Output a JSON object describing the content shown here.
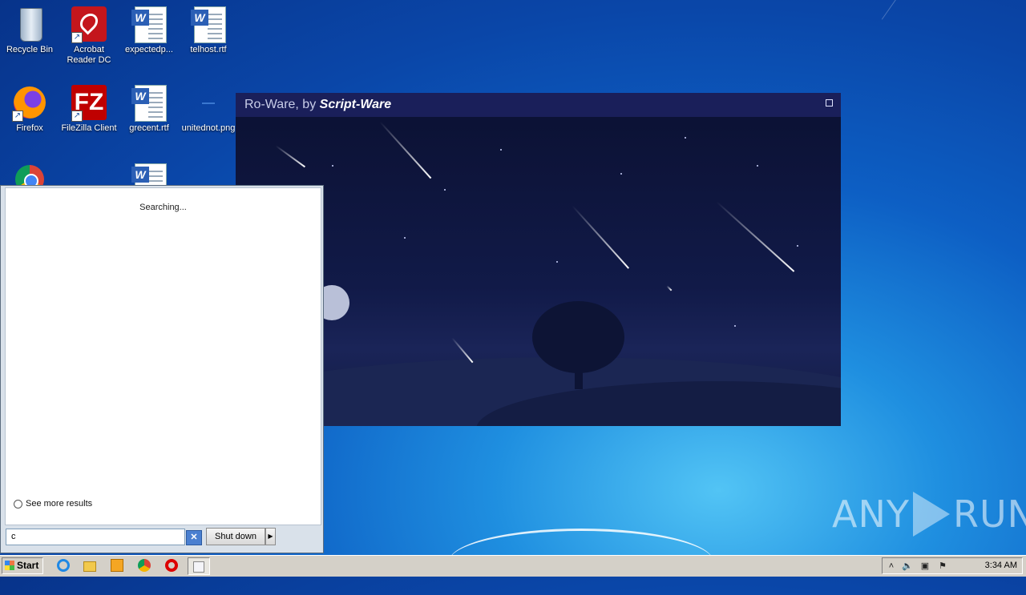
{
  "desktop": {
    "icons": [
      {
        "label": "Recycle Bin"
      },
      {
        "label": "Acrobat Reader DC"
      },
      {
        "label": "expectedp..."
      },
      {
        "label": "telhost.rtf"
      },
      {
        "label": "Firefox"
      },
      {
        "label": "FileZilla Client"
      },
      {
        "label": "grecent.rtf"
      },
      {
        "label": "unitednot.png"
      }
    ]
  },
  "roware": {
    "title_prefix": "Ro-Ware, by ",
    "title_brand": "Script-Ware"
  },
  "start_menu": {
    "status": "Searching...",
    "see_more": "See more results",
    "search_value": "c",
    "shutdown_label": "Shut down"
  },
  "taskbar": {
    "start_label": "Start",
    "clock": "3:34 AM"
  },
  "watermark": {
    "left": "ANY",
    "right": "RUN"
  },
  "colors": {
    "roware_titlebar": "#1a1f5a",
    "desktop_blue": "#0d5fc4",
    "taskbar": "#d4d0c8"
  }
}
